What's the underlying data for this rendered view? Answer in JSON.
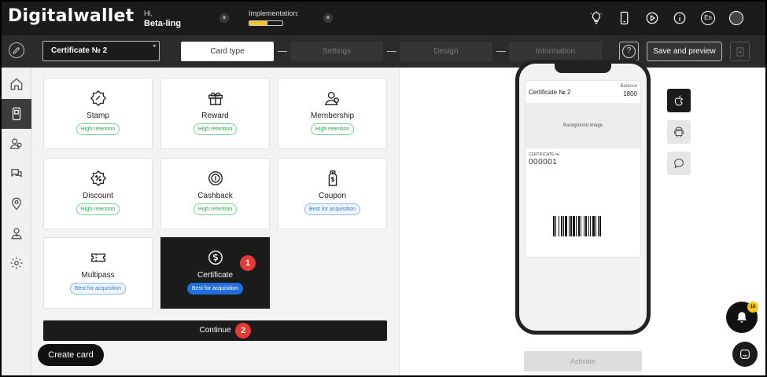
{
  "header": {
    "logo": "Digitalwallet",
    "greeting": "Hi,",
    "username": "Beta-ling",
    "implementation_label": "Implementation:",
    "implementation_progress": 0.55,
    "language": "En",
    "icons": [
      "lightbulb-icon",
      "phone-icon",
      "play-icon",
      "info-icon",
      "language-icon",
      "avatar"
    ]
  },
  "toolbar": {
    "card_name": "Certificate № 2",
    "required_mark": "*",
    "steps": [
      {
        "label": "Card type",
        "active": true
      },
      {
        "label": "Settings",
        "active": false
      },
      {
        "label": "Design",
        "active": false
      },
      {
        "label": "Information",
        "active": false
      }
    ],
    "help_label": "?",
    "save_label": "Save and preview"
  },
  "leftnav": {
    "items": [
      "home-icon",
      "cards-icon",
      "users-icon",
      "chat-icon",
      "location-icon",
      "user-upload-icon",
      "settings-icon"
    ],
    "active_index": 1
  },
  "card_types": [
    {
      "label": "Stamp",
      "badge": "High retention",
      "badge_type": "green",
      "icon": "stamp-icon"
    },
    {
      "label": "Reward",
      "badge": "High retention",
      "badge_type": "green",
      "icon": "gift-icon"
    },
    {
      "label": "Membership",
      "badge": "High retention",
      "badge_type": "green",
      "icon": "membership-icon"
    },
    {
      "label": "Discount",
      "badge": "High retention",
      "badge_type": "green",
      "icon": "discount-icon"
    },
    {
      "label": "Cashback",
      "badge": "High retention",
      "badge_type": "green",
      "icon": "cashback-icon"
    },
    {
      "label": "Coupon",
      "badge": "Best for acquisition",
      "badge_type": "blue",
      "icon": "coupon-icon"
    },
    {
      "label": "Multipass",
      "badge": "Best for acquisition",
      "badge_type": "blue",
      "icon": "ticket-icon"
    },
    {
      "label": "Certificate",
      "badge": "Best for acquisition",
      "badge_type": "solid-blue",
      "icon": "certificate-icon",
      "selected": true
    }
  ],
  "markers": {
    "one": "1",
    "two": "2"
  },
  "continue_label": "Continue",
  "create_card_label": "Create card",
  "preview": {
    "pass_name": "Certificate № 2",
    "balance_label": "Balance",
    "balance_value": "1800",
    "background_label": "Background image",
    "certificate_label": "CERTIFICATE №",
    "certificate_number": "000001",
    "activate_label": "Activate",
    "platforms": [
      "apple-icon",
      "android-icon",
      "message-icon"
    ],
    "notification_count": "10"
  }
}
